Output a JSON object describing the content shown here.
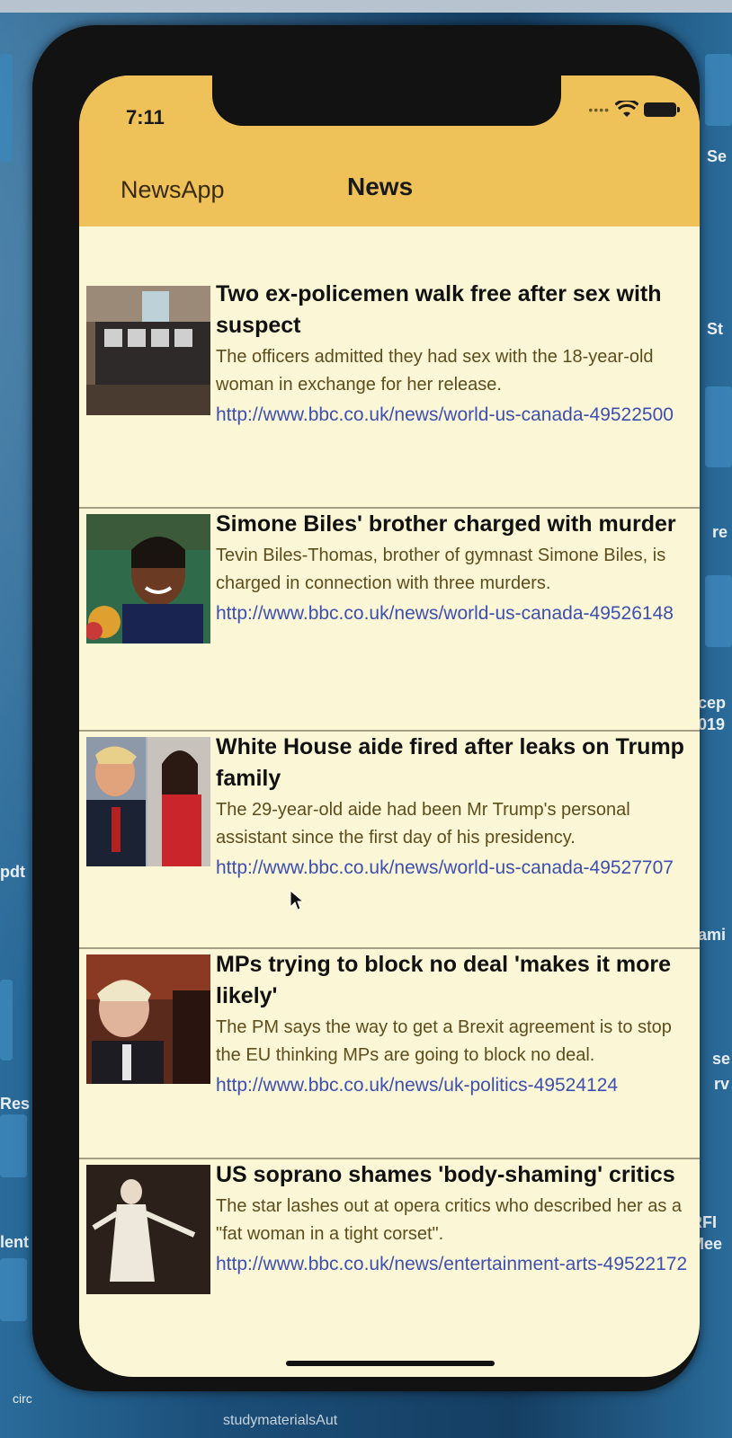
{
  "side": {
    "labels": [
      "Se",
      "St",
      "re",
      "cep",
      "019",
      "pdt",
      "ami",
      "Res",
      "lent",
      "RFI",
      "Mee",
      "se",
      "rv",
      "circ",
      "studymaterialsAut"
    ]
  },
  "status_bar": {
    "time": "7:11"
  },
  "nav": {
    "back_label": "NewsApp",
    "title": "News"
  },
  "articles": [
    {
      "title": "Two ex-policemen walk free after sex with suspect",
      "description": "The officers admitted they had sex with the 18-year-old woman in exchange for her release.",
      "url": "http://www.bbc.co.uk/news/world-us-canada-49522500"
    },
    {
      "title": "Simone Biles' brother charged with murder",
      "description": "Tevin Biles-Thomas, brother of gymnast Simone Biles, is charged in connection with three murders.",
      "url": "http://www.bbc.co.uk/news/world-us-canada-49526148"
    },
    {
      "title": "White House aide fired after leaks on Trump family",
      "description": "The 29-year-old aide had been Mr Trump's personal assistant since the first day of his presidency.",
      "url": "http://www.bbc.co.uk/news/world-us-canada-49527707"
    },
    {
      "title": "MPs trying to block no deal 'makes it more likely'",
      "description": "The PM says the way to get a Brexit agreement is to stop the EU thinking MPs are going to block no deal.",
      "url": "http://www.bbc.co.uk/news/uk-politics-49524124"
    },
    {
      "title": "US soprano shames 'body-shaming' critics",
      "description": "The star lashes out at opera critics who described her as a \"fat woman in a tight corset\".",
      "url": "http://www.bbc.co.uk/news/entertainment-arts-49522172"
    }
  ],
  "colors": {
    "header": "#eec259",
    "list_background": "#fbf6d6",
    "link": "#3d4fb0"
  }
}
